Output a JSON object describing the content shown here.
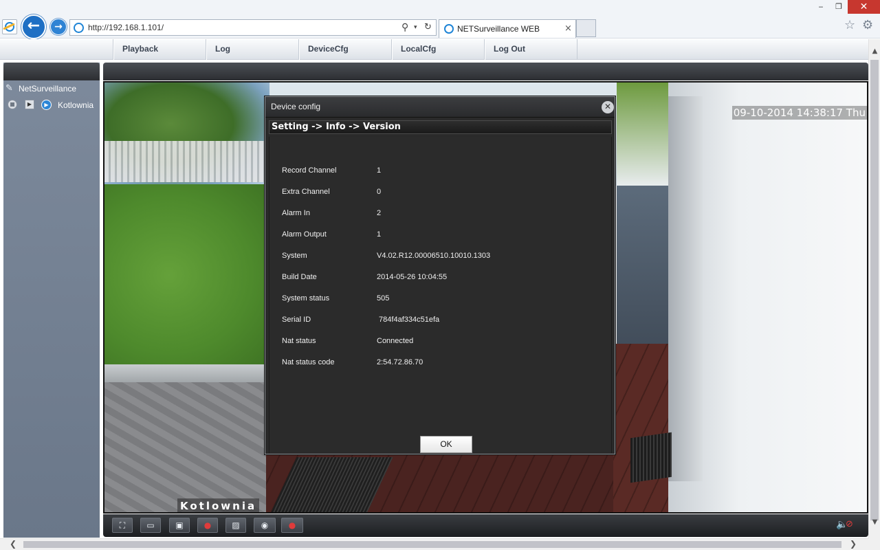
{
  "browser": {
    "url": "http://192.168.1.101/",
    "tab_title": "NETSurveillance WEB",
    "tab_close": "×",
    "minimize": "‒",
    "restore": "❐",
    "close": "✕",
    "back_icon": "←",
    "forward_icon": "→",
    "search_icon": "⚲",
    "dropdown_icon": "▾",
    "refresh_icon": "↻",
    "favorites_icon": "☆",
    "tools_icon": "⚙"
  },
  "menu": {
    "items": [
      {
        "label": "Playback"
      },
      {
        "label": "Log"
      },
      {
        "label": "DeviceCfg"
      },
      {
        "label": "LocalCfg"
      },
      {
        "label": "Log Out"
      }
    ]
  },
  "tree": {
    "root": "NetSurveillance",
    "root_icon": "✎",
    "channel": "Kotlownia",
    "play_icon": "▶",
    "camera_icon": "▶"
  },
  "video": {
    "osd_time": "09-10-2014 14:38:17 Thu",
    "osd_name": "Kotlownia"
  },
  "toolbar": {
    "buttons": [
      {
        "icon": "⛶"
      },
      {
        "icon": "▭"
      },
      {
        "icon": "▣"
      },
      {
        "icon": "●"
      },
      {
        "icon": "▨"
      },
      {
        "icon": "◉"
      },
      {
        "icon": "●"
      }
    ],
    "speaker_icon": "🔈",
    "mute_icon": "⊘"
  },
  "dialog": {
    "title": "Device config",
    "close_icon": "✕",
    "breadcrumb": "Setting -> Info -> Version",
    "rows": [
      {
        "label": "Record Channel",
        "value": "1"
      },
      {
        "label": "Extra Channel",
        "value": "0"
      },
      {
        "label": "Alarm In",
        "value": "2"
      },
      {
        "label": "Alarm Output",
        "value": "1"
      },
      {
        "label": "System",
        "value": "V4.02.R12.00006510.10010.1303"
      },
      {
        "label": "Build Date",
        "value": "2014-05-26 10:04:55"
      },
      {
        "label": "System status",
        "value": "505"
      },
      {
        "label": "Serial ID",
        "value": " 784f4af334c51efa"
      },
      {
        "label": "Nat status",
        "value": "Connected"
      },
      {
        "label": "Nat status code",
        "value": "2:54.72.86.70"
      }
    ],
    "ok_label": "OK"
  },
  "scrollbars": {
    "up": "▲",
    "down": "▼",
    "left": "❮",
    "right": "❯"
  }
}
